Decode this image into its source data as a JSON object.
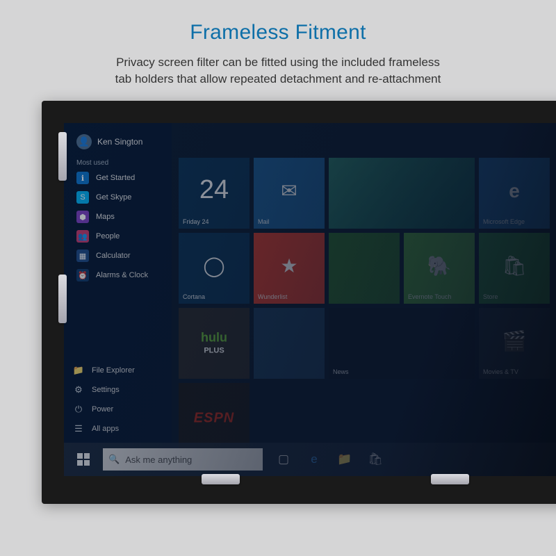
{
  "header": {
    "title": "Frameless Fitment",
    "subtitle_line1": "Privacy screen filter can be fitted using the included frameless",
    "subtitle_line2": "tab holders that allow repeated detachment and re-attachment"
  },
  "user": {
    "name": "Ken Sington"
  },
  "sidebar": {
    "section_label": "Most used",
    "items": [
      {
        "label": "Get Started",
        "icon": "ℹ"
      },
      {
        "label": "Get Skype",
        "icon": "S"
      },
      {
        "label": "Maps",
        "icon": "⬢"
      },
      {
        "label": "People",
        "icon": "👥"
      },
      {
        "label": "Calculator",
        "icon": "▦"
      },
      {
        "label": "Alarms & Clock",
        "icon": "⏰"
      }
    ],
    "bottom": [
      {
        "label": "File Explorer",
        "icon": "📁"
      },
      {
        "label": "Settings",
        "icon": "⚙"
      },
      {
        "label": "Power",
        "icon": "⏻"
      },
      {
        "label": "All apps",
        "icon": "☰"
      }
    ]
  },
  "tiles": {
    "calendar": {
      "label": "Friday 24",
      "sub": "24"
    },
    "mail": {
      "label": "Mail"
    },
    "photos": {
      "label": ""
    },
    "edge": {
      "label": "Microsoft Edge"
    },
    "cortana": {
      "label": "Cortana"
    },
    "wunderlist": {
      "label": "Wunderlist"
    },
    "evernote": {
      "label": "Evernote Touch"
    },
    "store": {
      "label": "Store"
    },
    "hulu": {
      "label": "",
      "brand": "hulu",
      "brand2": "PLUS"
    },
    "news": {
      "label": "News"
    },
    "movies": {
      "label": "Movies & TV"
    },
    "espn": {
      "label": "",
      "brand": "ESPN"
    }
  },
  "taskbar": {
    "search_placeholder": "Ask me anything"
  }
}
